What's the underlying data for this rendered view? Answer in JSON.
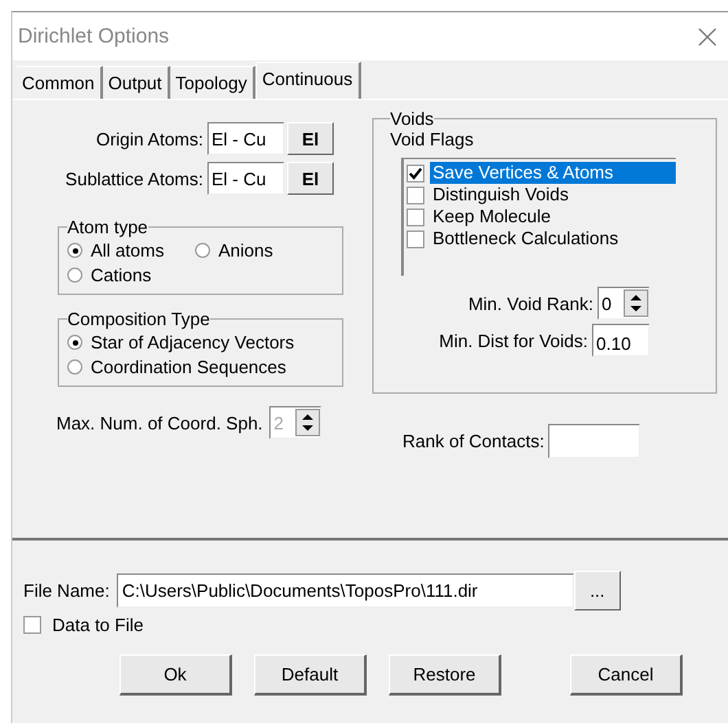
{
  "window": {
    "title": "Dirichlet Options"
  },
  "tabs": [
    {
      "label": "Common",
      "selected": false
    },
    {
      "label": "Output",
      "selected": false
    },
    {
      "label": "Topology",
      "selected": false
    },
    {
      "label": "Continuous",
      "selected": true
    }
  ],
  "origin_atoms": {
    "label": "Origin Atoms:",
    "value": "El - Cu",
    "button": "El"
  },
  "sublattice_atoms": {
    "label": "Sublattice Atoms:",
    "value": "El - Cu",
    "button": "El"
  },
  "atom_type": {
    "title": "Atom type",
    "options": [
      {
        "label": "All atoms",
        "selected": true
      },
      {
        "label": "Anions",
        "selected": false
      },
      {
        "label": "Cations",
        "selected": false
      }
    ]
  },
  "composition_type": {
    "title": "Composition Type",
    "options": [
      {
        "label": "Star of Adjacency Vectors",
        "selected": true
      },
      {
        "label": "Coordination Sequences",
        "selected": false
      }
    ]
  },
  "max_coord_sph": {
    "label": "Max. Num. of Coord. Sph.",
    "value": "2",
    "disabled": true
  },
  "voids": {
    "title": "Voids",
    "flags_title": "Void Flags",
    "flags": [
      {
        "label": "Save Vertices & Atoms",
        "checked": true,
        "selected": true
      },
      {
        "label": "Distinguish Voids",
        "checked": false,
        "selected": false
      },
      {
        "label": "Keep Molecule",
        "checked": false,
        "selected": false
      },
      {
        "label": "Bottleneck Calculations",
        "checked": false,
        "selected": false
      }
    ],
    "min_void_rank": {
      "label": "Min. Void Rank:",
      "value": "0"
    },
    "min_dist": {
      "label": "Min. Dist for Voids:",
      "value": "0.10"
    }
  },
  "rank_of_contacts": {
    "label": "Rank of Contacts:"
  },
  "file_name": {
    "label": "File Name:",
    "value": "C:\\Users\\Public\\Documents\\ToposPro\\111.dir",
    "browse": "..."
  },
  "data_to_file": {
    "label": "Data to File",
    "checked": false
  },
  "buttons": [
    "Ok",
    "Default",
    "Restore",
    "Cancel"
  ]
}
